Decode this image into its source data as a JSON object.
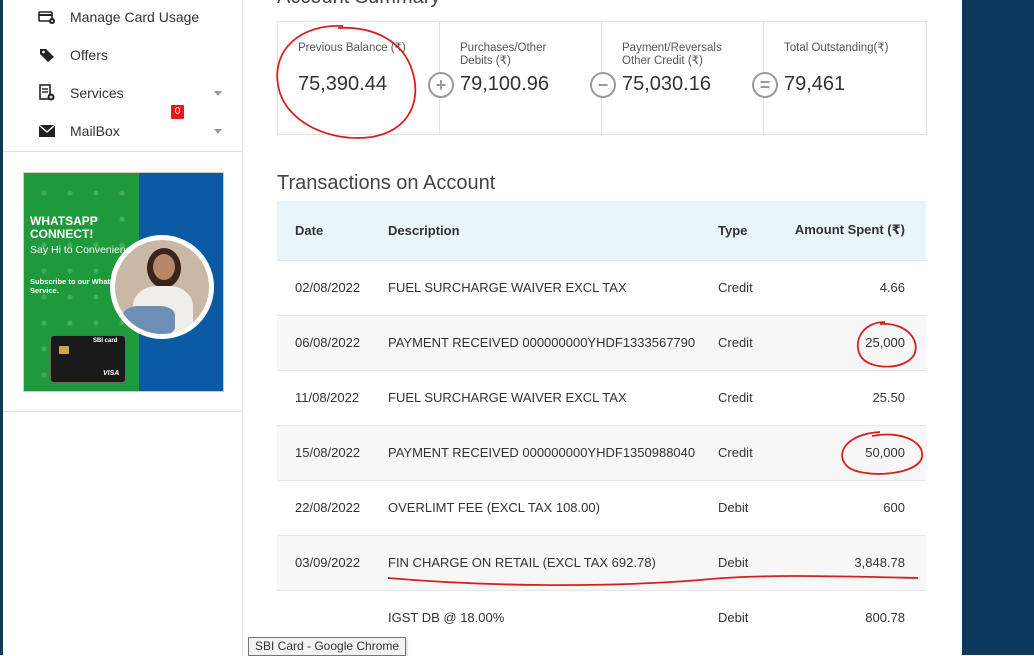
{
  "sidebar": {
    "items": [
      {
        "label": "Manage Card Usage",
        "icon": "card-settings-icon",
        "caret": false
      },
      {
        "label": "Offers",
        "icon": "tag-icon",
        "caret": false
      },
      {
        "label": "Services",
        "icon": "services-icon",
        "caret": true
      },
      {
        "label": "MailBox",
        "icon": "envelope-icon",
        "caret": true,
        "badge": "0"
      }
    ]
  },
  "promo": {
    "headline": "WHATSAPP CONNECT!",
    "subline": "Say Hi to Convenience.",
    "cta": "Subscribe to our WhatsApp Service.",
    "card_brand": "SBI card",
    "card_network": "VISA"
  },
  "account_summary": {
    "title": "Account Summary",
    "items": [
      {
        "label": "Previous Balance (₹)",
        "value": "75,390.44"
      },
      {
        "label": "Purchases/Other Debits (₹)",
        "value": "79,100.96"
      },
      {
        "label": "Payment/Reversals Other Credit (₹)",
        "value": "75,030.16"
      },
      {
        "label": "Total Outstanding(₹)",
        "value": "79,461"
      }
    ],
    "operators": [
      "+",
      "−",
      "="
    ]
  },
  "transactions": {
    "title": "Transactions on Account",
    "columns": [
      "Date",
      "Description",
      "Type",
      "Amount Spent (₹)"
    ],
    "rows": [
      {
        "date": "02/08/2022",
        "description": "FUEL SURCHARGE WAIVER EXCL TAX",
        "type": "Credit",
        "amount": "4.66"
      },
      {
        "date": "06/08/2022",
        "description": "PAYMENT RECEIVED 000000000YHDF1333567790",
        "type": "Credit",
        "amount": "25,000"
      },
      {
        "date": "11/08/2022",
        "description": "FUEL SURCHARGE WAIVER EXCL TAX",
        "type": "Credit",
        "amount": "25.50"
      },
      {
        "date": "15/08/2022",
        "description": "PAYMENT RECEIVED 000000000YHDF1350988040",
        "type": "Credit",
        "amount": "50,000"
      },
      {
        "date": "22/08/2022",
        "description": "OVERLIMT FEE (EXCL TAX 108.00)",
        "type": "Debit",
        "amount": "600"
      },
      {
        "date": "03/09/2022",
        "description": "FIN CHARGE ON RETAIL (EXCL TAX 692.78)",
        "type": "Debit",
        "amount": "3,848.78"
      },
      {
        "date": "",
        "description": "IGST DB @ 18.00%",
        "type": "Debit",
        "amount": "800.78"
      }
    ]
  },
  "tooltip": "SBI Card - Google Chrome",
  "colors": {
    "accent_navy": "#0b3a5c",
    "annotation_red": "#d81f1f",
    "table_header_bg": "#e9f4fb"
  }
}
